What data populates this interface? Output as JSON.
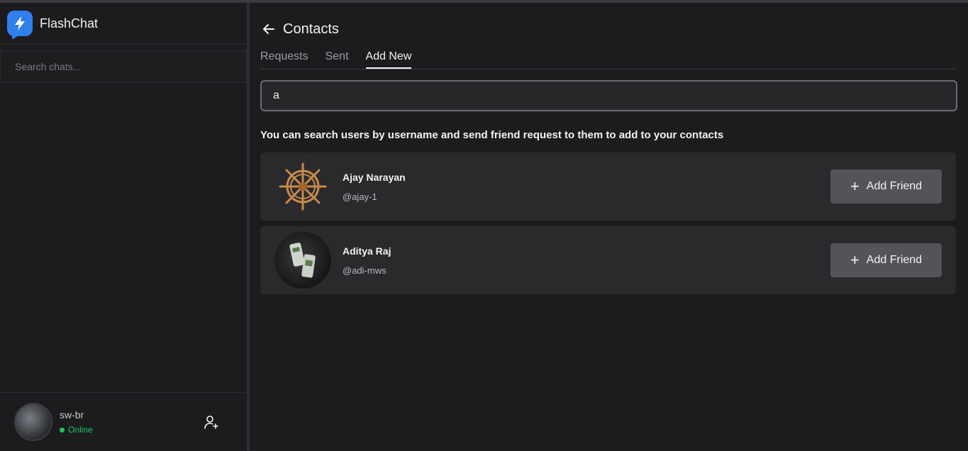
{
  "app": {
    "name": "FlashChat",
    "accent": "#2f80ed"
  },
  "sidebar": {
    "search_placeholder": "Search chats...",
    "user": {
      "username": "sw-br",
      "status": "Online",
      "status_color": "#22c55e"
    }
  },
  "contacts": {
    "title": "Contacts",
    "tabs": [
      {
        "label": "Requests"
      },
      {
        "label": "Sent"
      },
      {
        "label": "Add New"
      }
    ],
    "active_tab": "Add New",
    "search_value": "a",
    "hint": "You can search users by username and send friend request to them to add to your contacts",
    "results": [
      {
        "name": "Ajay Narayan",
        "handle": "@ajay-1",
        "action": "Add Friend"
      },
      {
        "name": "Aditya Raj",
        "handle": "@adi-mws",
        "action": "Add Friend"
      }
    ]
  }
}
